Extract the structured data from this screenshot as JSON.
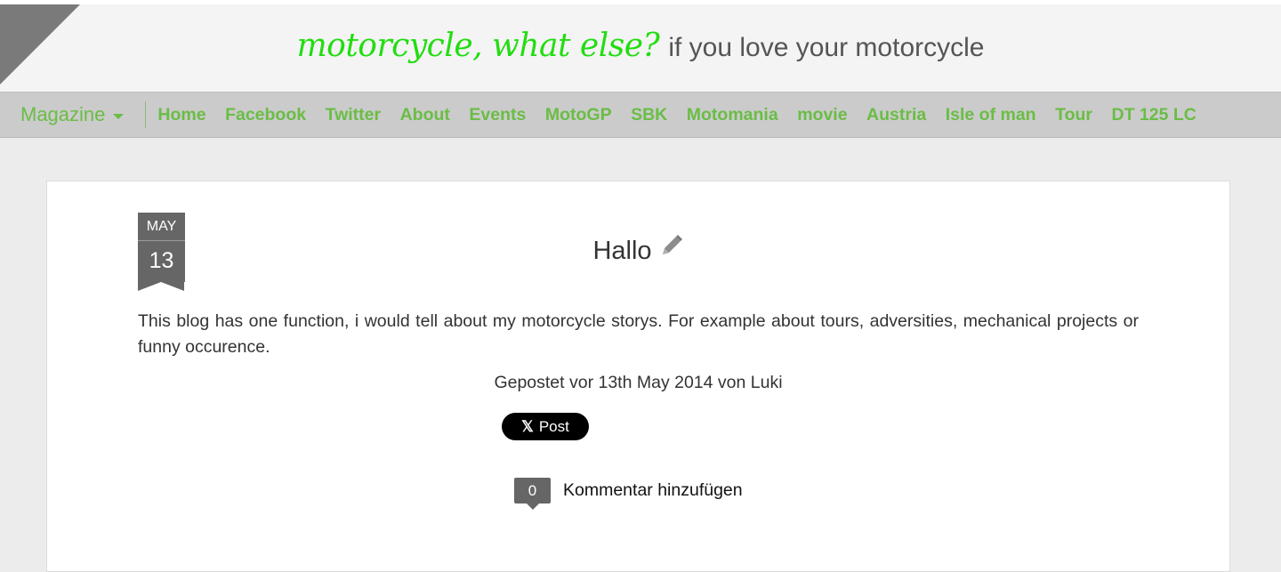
{
  "header": {
    "brand": "motorcycle, what else?",
    "tagline": "if you love your motorcycle"
  },
  "nav": {
    "dropdown_label": "Magazine",
    "links": [
      "Home",
      "Facebook",
      "Twitter",
      "About",
      "Events",
      "MotoGP",
      "SBK",
      "Motomania",
      "movie",
      "Austria",
      "Isle of man",
      "Tour",
      "DT 125 LC"
    ]
  },
  "post": {
    "date_month": "MAY",
    "date_day": "13",
    "title": "Hallo",
    "body": "This blog has one function, i would tell about my motorcycle storys. For example about tours, adversities, mechanical projects or funny occurence.",
    "meta": "Gepostet vor 13th May 2014 von Luki",
    "share_label": "Post",
    "share_icon": "x-logo-icon",
    "comment_count": "0",
    "comment_label": "Kommentar hinzufügen"
  },
  "colors": {
    "brand": "#22dd11",
    "nav_link": "#6abd45",
    "nav_bg": "#cbcbcb",
    "badge": "#666666"
  }
}
